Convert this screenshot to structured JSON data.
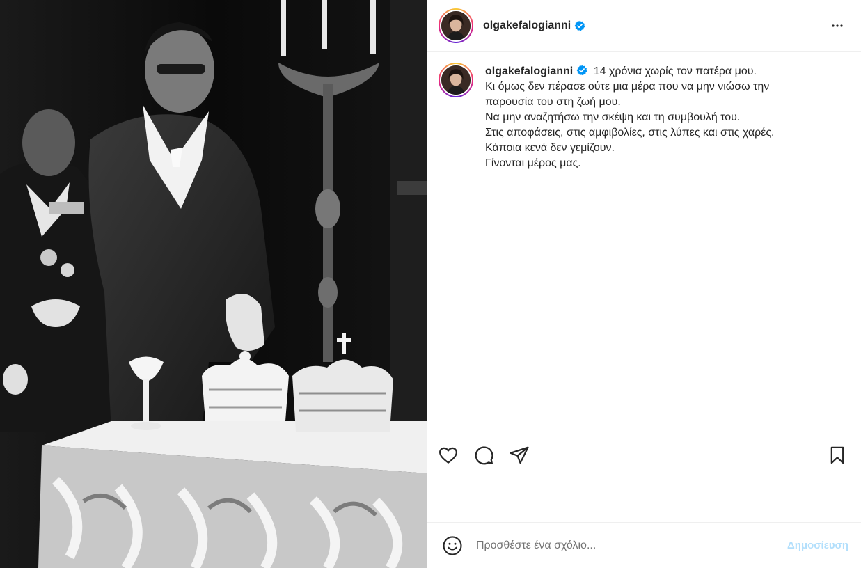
{
  "post": {
    "username": "olgakefalogianni",
    "verified_icon": "verified-badge-icon",
    "more_icon": "more-options-icon",
    "caption": {
      "username": "olgakefalogianni",
      "lines": [
        "14 χρόνια χωρίς τον πατέρα μου.",
        "Κι όμως δεν πέρασε ούτε μια μέρα που να μην νιώσω την",
        "παρουσία του στη ζωή μου.",
        "Να μην αναζητήσω την σκέψη και τη συμβουλή του.",
        "Στις αποφάσεις, στις αμφιβολίες, στις λύπες και στις χαρές.",
        "Κάποια κενά δεν γεμίζουν.",
        "Γίνονται μέρος μας."
      ]
    },
    "image_description_icon": "black-and-white-ceremony-photo"
  },
  "actions": {
    "like_icon": "heart-icon",
    "comment_icon": "comment-icon",
    "share_icon": "share-icon",
    "save_icon": "bookmark-icon"
  },
  "comment_bar": {
    "emoji_icon": "emoji-icon",
    "placeholder": "Προσθέστε ένα σχόλιο...",
    "post_label": "Δημοσίευση"
  },
  "colors": {
    "accent": "#0095f6",
    "post_disabled": "#b2dffc",
    "verified": "#0095f6",
    "border": "#efefef"
  }
}
